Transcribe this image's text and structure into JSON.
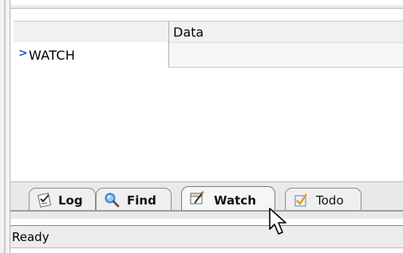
{
  "table": {
    "columns": [
      "",
      "Data"
    ],
    "rows": [
      {
        "name": "WATCH",
        "data": "",
        "marker": ">"
      }
    ]
  },
  "tabs": [
    {
      "label": "Log",
      "icon": "log-checklist-icon",
      "bold": true
    },
    {
      "label": "Find",
      "icon": "magnifier-icon",
      "bold": true
    },
    {
      "label": "Watch",
      "icon": "watch-notepad-icon",
      "bold": true,
      "active": true
    },
    {
      "label": "Todo",
      "icon": "todo-check-icon",
      "bold": false
    }
  ],
  "status": {
    "text": "Ready"
  },
  "colors": {
    "row_marker": "#1a5ad9",
    "todo_check": "#d9a316",
    "magnifier_glass": "#3f7fd6",
    "background": "#ffffff",
    "chrome": "#e9e9e9"
  }
}
